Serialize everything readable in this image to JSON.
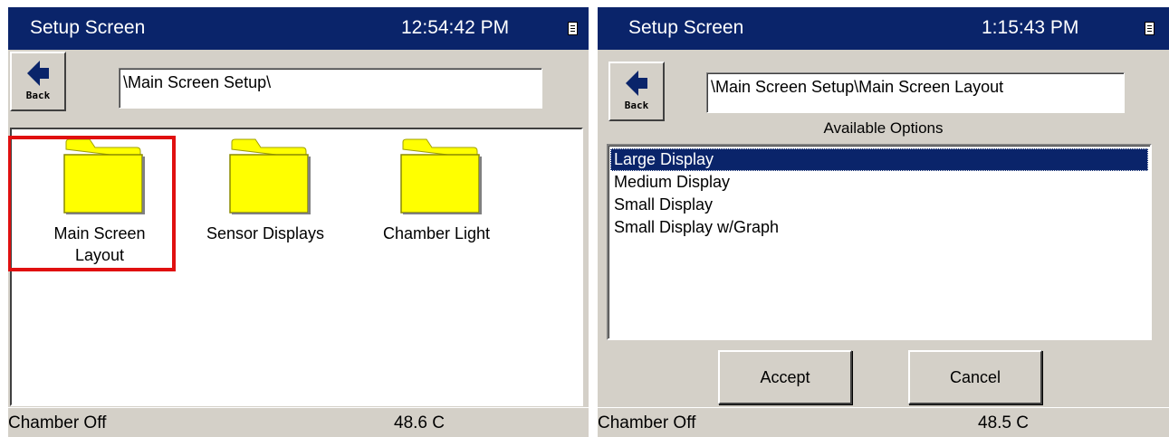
{
  "left_screen": {
    "title": "Setup Screen",
    "time": "12:54:42 PM",
    "back_label": "Back",
    "path": "\\Main Screen Setup\\",
    "folders": [
      {
        "label": "Main Screen Layout",
        "line1": "Main Screen",
        "line2": "Layout",
        "highlighted": true
      },
      {
        "label": "Sensor Displays",
        "line1": "Sensor Displays",
        "line2": ""
      },
      {
        "label": "Chamber Light",
        "line1": "Chamber Light",
        "line2": ""
      }
    ],
    "status_left": "Chamber Off",
    "status_right": "48.6 C"
  },
  "right_screen": {
    "title": "Setup Screen",
    "time": "1:15:43 PM",
    "back_label": "Back",
    "path": "\\Main Screen Setup\\Main Screen Layout",
    "options_heading": "Available Options",
    "options": [
      "Large Display",
      "Medium Display",
      "Small Display",
      "Small Display w/Graph"
    ],
    "selected_option": "Large Display",
    "accept_label": "Accept",
    "cancel_label": "Cancel",
    "status_left": "Chamber Off",
    "status_right": "48.5 C"
  },
  "colors": {
    "titlebar": "#0a246a",
    "chrome": "#d4d0c8",
    "folder": "#ffff00",
    "highlight": "#e01010"
  }
}
